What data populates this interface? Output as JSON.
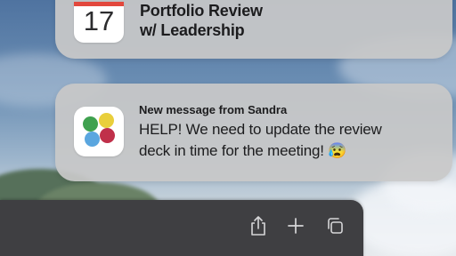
{
  "notifications": [
    {
      "app_icon": "calendar-icon",
      "calendar_day": "17",
      "title_line1": "Portfolio Review",
      "title_line2": "w/ Leadership"
    },
    {
      "app_icon": "colored-dots-app-icon",
      "header": "New message from Sandra",
      "body": "HELP! We need to update the review deck in time for the meeting! 😰"
    }
  ],
  "toolbar": {
    "icons": [
      "share-icon",
      "plus-icon",
      "tabs-icon"
    ]
  },
  "colors": {
    "calendar_red": "#e2483d",
    "dot_green": "#3fa14f",
    "dot_yellow": "#e9cf3c",
    "dot_blue": "#5aa6df",
    "dot_red": "#c0304a",
    "card_bg": "#c8c8c8",
    "toolbar_bg": "#3f3f42"
  }
}
